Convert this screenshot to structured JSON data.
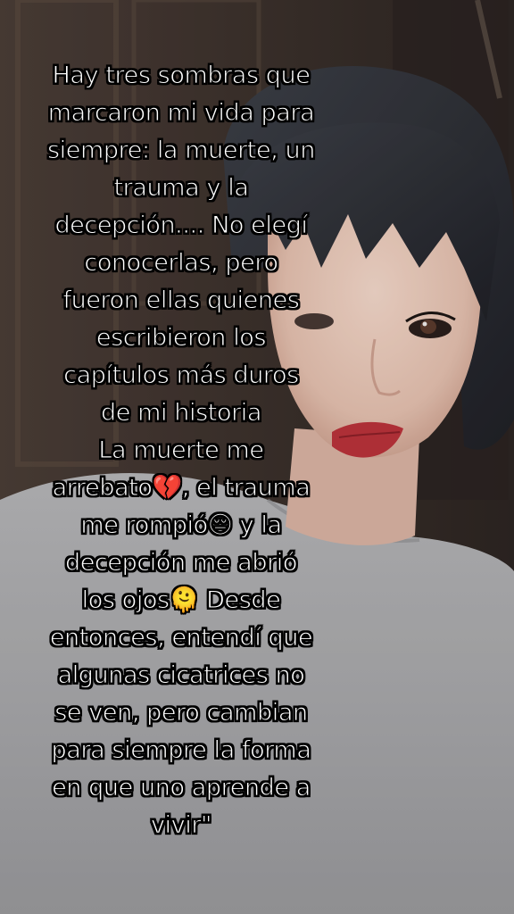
{
  "caption": {
    "lines": [
      "Hay tres sombras que",
      "marcaron mi vida para",
      "siempre: la muerte, un",
      "trauma y la",
      "decepción.... No elegí",
      "conocerlas, pero",
      "fueron ellas quienes",
      "escribieron los",
      "capítulos más duros",
      "de mi historia",
      "La muerte me",
      "arrebato💔, el trauma",
      "me rompió😔 y la",
      "decepción me abrió",
      "los ojos🫠 Desde",
      "entonces, entendí que",
      "algunas cicatrices no",
      "se ven, pero cambian",
      "para siempre la forma",
      "en que uno aprende a",
      "vivir\""
    ]
  },
  "colors": {
    "caption_text": "#ffffff",
    "caption_outline": "#000000",
    "sweater": "#a9a9ab",
    "hair": "#2b2d33",
    "skin": "#e8c7b6",
    "lips": "#b8323a",
    "background_door": "#3a302c"
  }
}
